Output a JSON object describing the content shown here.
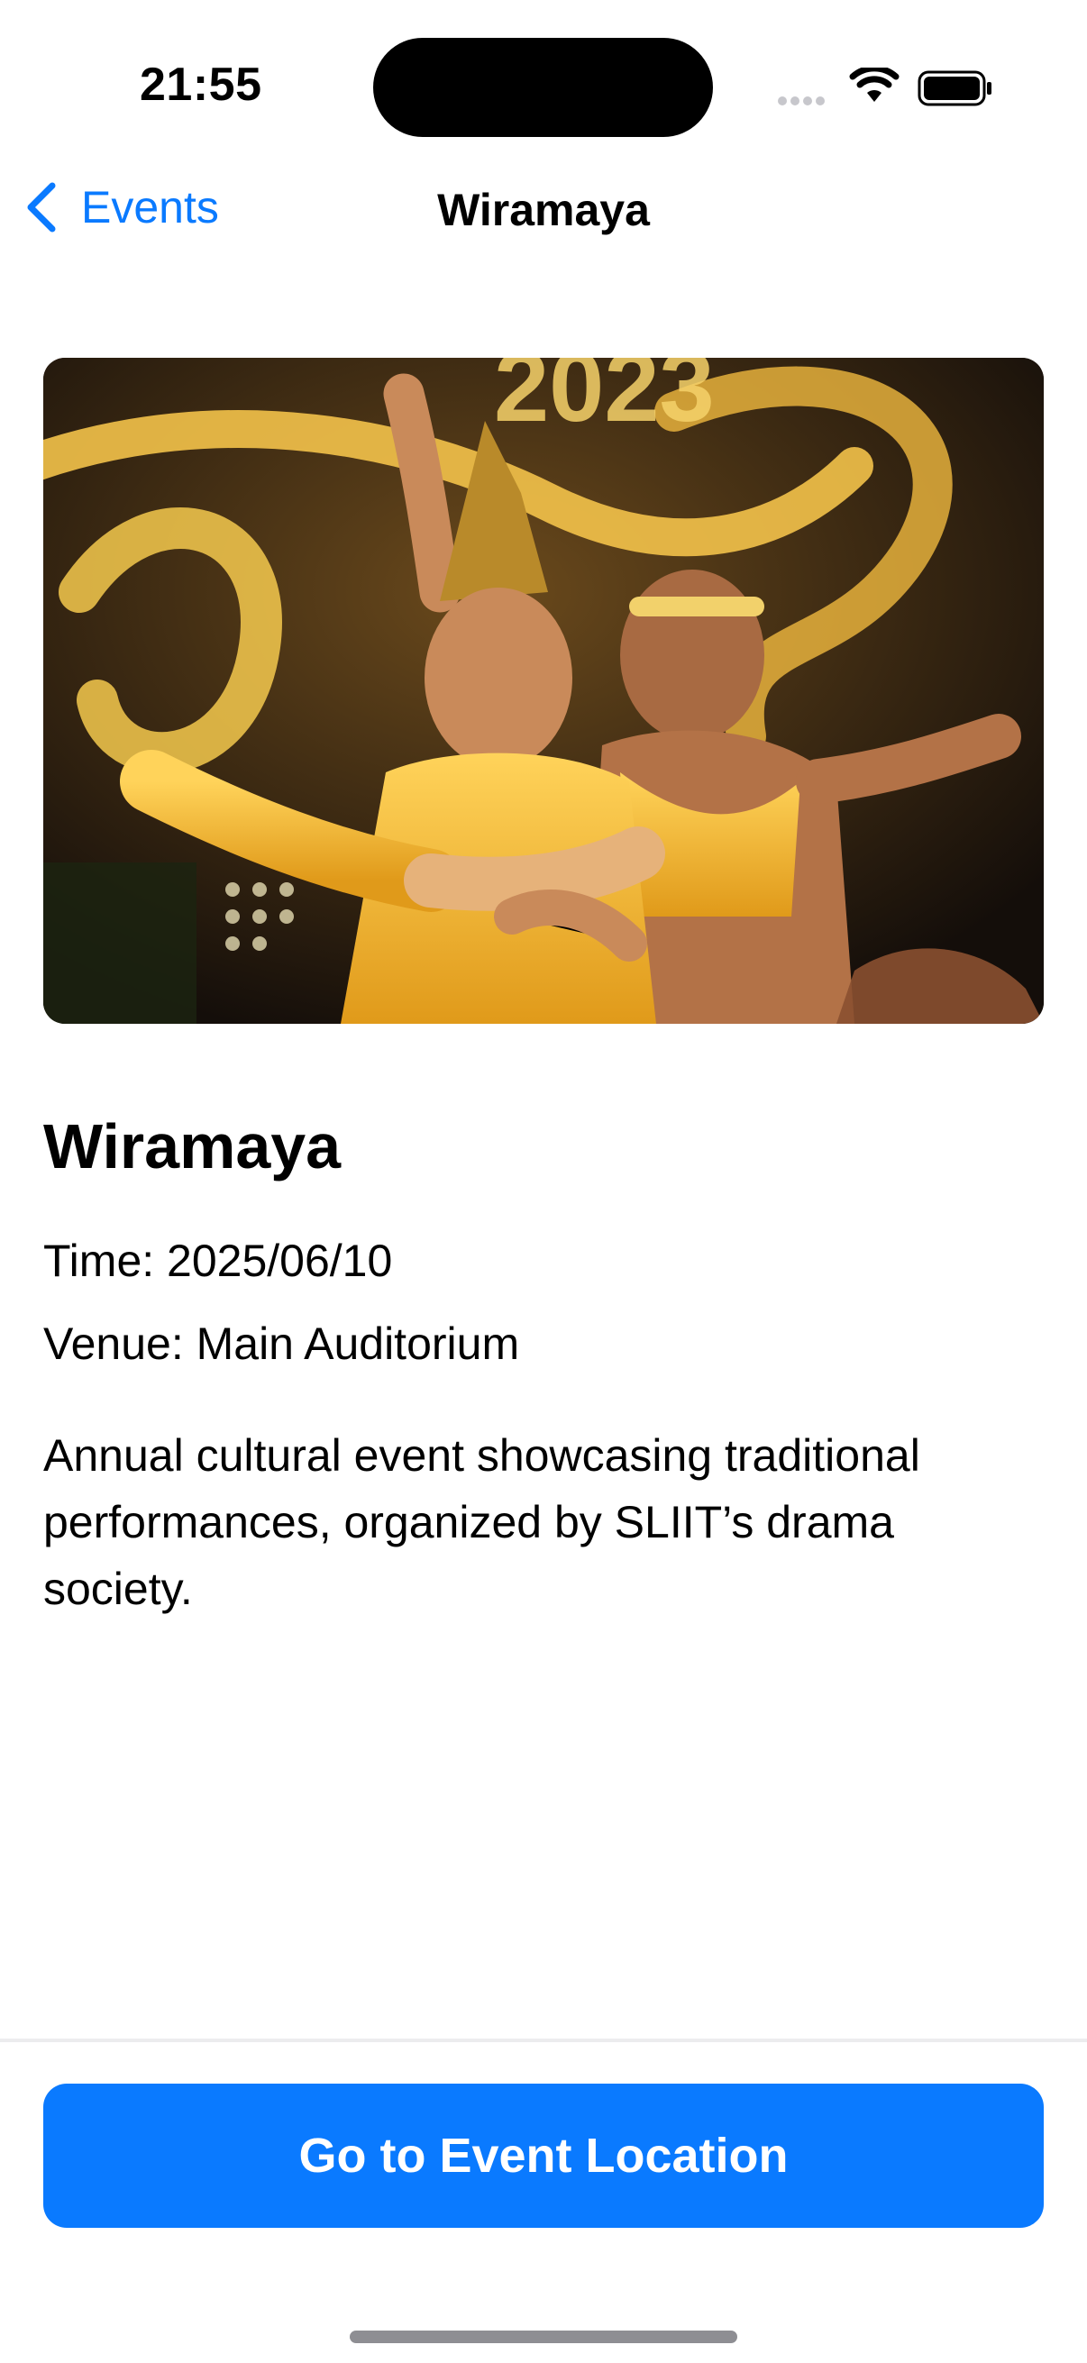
{
  "status_bar": {
    "time": "21:55"
  },
  "nav": {
    "back_label": "Events",
    "title": "Wiramaya"
  },
  "hero": {
    "image_label": "2023"
  },
  "event": {
    "name": "Wiramaya",
    "time": "Time: 2025/06/10",
    "venue": "Venue: Main Auditorium",
    "description": "Annual cultural event showcasing traditional performances, organized by SLIIT’s drama society."
  },
  "actions": {
    "primary_label": "Go to Event Location"
  },
  "colors": {
    "accent": "#0a7aff",
    "background": "#ffffff",
    "text": "#000000"
  }
}
